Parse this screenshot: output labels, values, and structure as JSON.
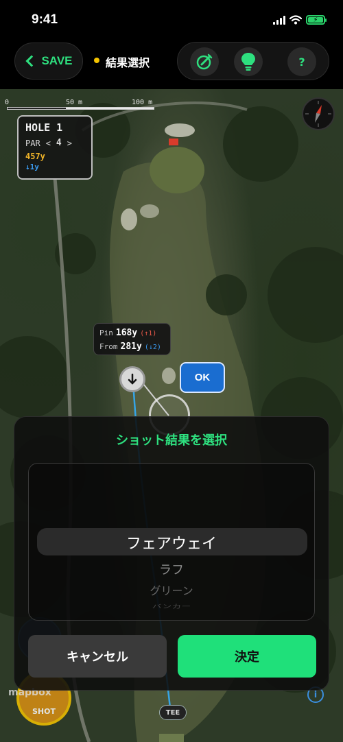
{
  "status_bar": {
    "time": "9:41"
  },
  "top_nav": {
    "save_label": "SAVE",
    "mode_label": "結果選択",
    "help_label": "?"
  },
  "map": {
    "scale_labels": [
      "0",
      "50 m",
      "100 m"
    ],
    "hole_card": {
      "title": "HOLE 1",
      "par_label": "PAR",
      "par_value": "4",
      "prev": "<",
      "next": ">",
      "yardage": "457y",
      "elevation": "↓1y"
    },
    "distance_card": {
      "pin_label": "Pin",
      "pin_value": "168y",
      "pin_delta": "(↑1)",
      "from_label": "From",
      "from_value": "281y",
      "from_delta": "(↓2)"
    },
    "ok_label": "OK",
    "tee_label": "TEE",
    "shot_label": "SHOT",
    "attribution": "mapbox",
    "info_label": "i"
  },
  "modal": {
    "title": "ショット結果を選択",
    "options": [
      "フェアウェイ",
      "ラフ",
      "グリーン",
      "バンカー"
    ],
    "selected": "フェアウェイ",
    "cancel_label": "キャンセル",
    "confirm_label": "決定"
  },
  "colors": {
    "accent_green": "#2ee07f",
    "yardage_orange": "#f0b429",
    "elevation_blue": "#3b9cf2",
    "ok_blue": "#1a6dd0",
    "mode_dot": "#f5c400"
  }
}
